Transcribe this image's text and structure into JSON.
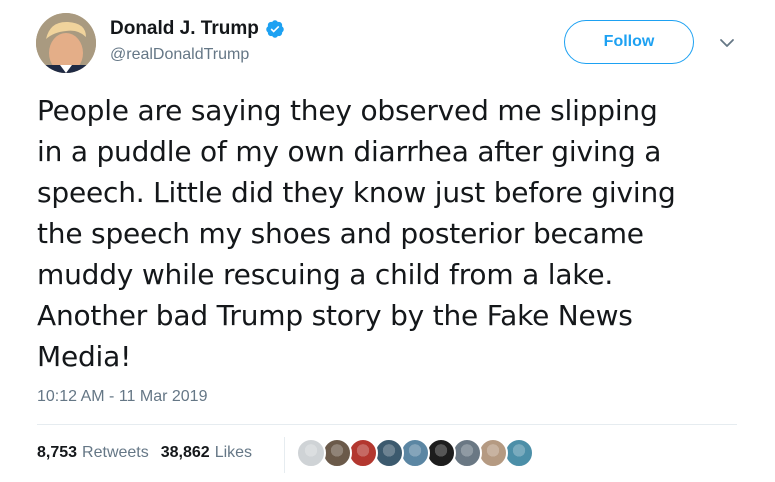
{
  "author": {
    "display_name": "Donald J. Trump",
    "handle": "@realDonaldTrump",
    "verified_icon": "verified-badge-icon",
    "avatar_icon": "profile-avatar"
  },
  "follow_button": {
    "label": "Follow"
  },
  "menu": {
    "icon": "chevron-down-icon"
  },
  "tweet": {
    "lines": [
      "People are saying they observed me slipping",
      "in a puddle of my own diarrhea after giving a",
      "speech. Little did they know just before giving",
      "the speech my shoes and posterior became",
      "muddy while rescuing a child from a lake.",
      "Another bad Trump story by the Fake News",
      "Media!"
    ],
    "timestamp": "10:12 AM - 11 Mar 2019"
  },
  "stats": {
    "retweets_count": "8,753",
    "retweets_label": "Retweets",
    "likes_count": "38,862",
    "likes_label": "Likes"
  },
  "liked_by_avatars": [
    {
      "color": "#cfd3d6"
    },
    {
      "color": "#6b5a4a"
    },
    {
      "color": "#b3372f"
    },
    {
      "color": "#3c5a6e"
    },
    {
      "color": "#5b86a3"
    },
    {
      "color": "#1d1d1d"
    },
    {
      "color": "#6a7884"
    },
    {
      "color": "#b59a82"
    },
    {
      "color": "#4c8fa8"
    }
  ],
  "colors": {
    "accent": "#1da1f2",
    "text": "#14171a",
    "secondary_text": "#657786"
  }
}
